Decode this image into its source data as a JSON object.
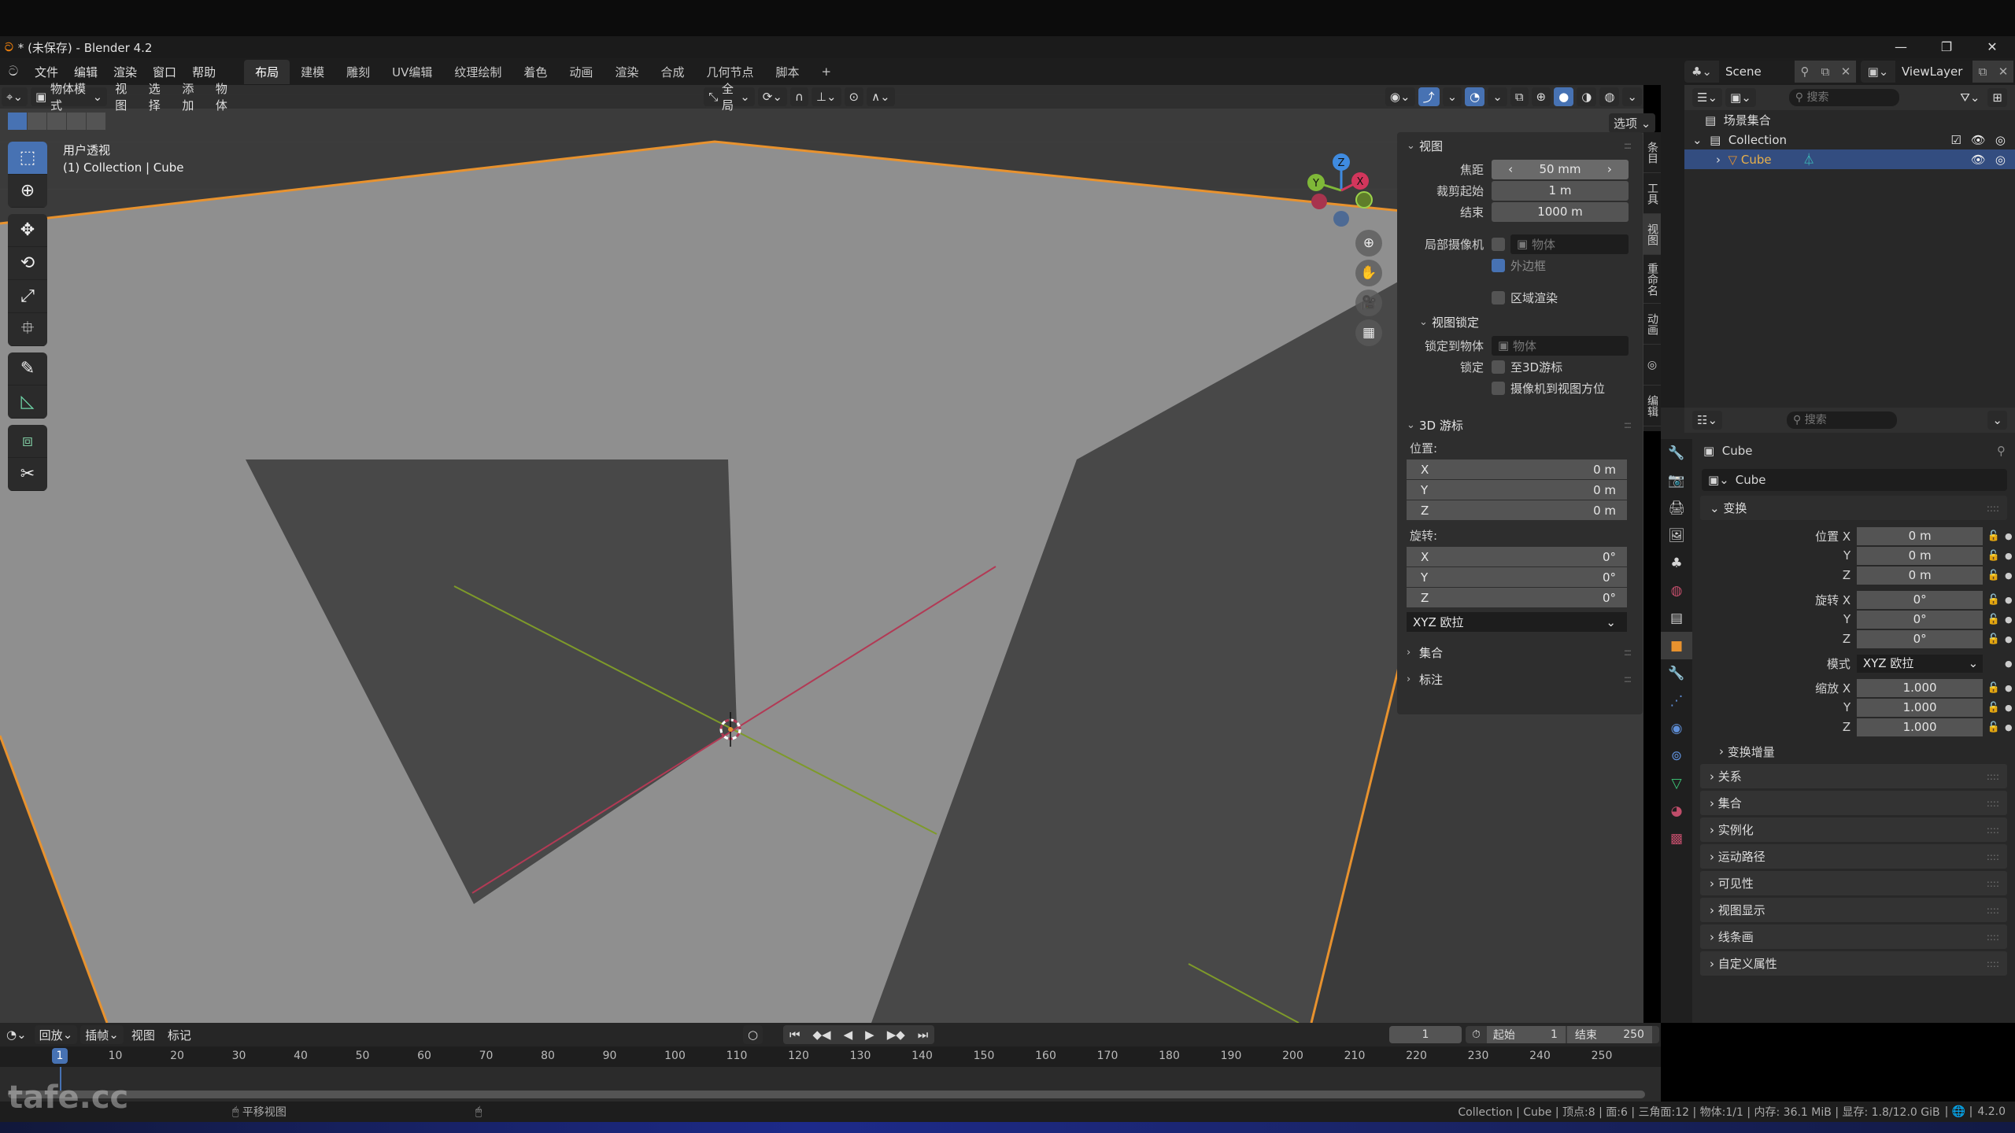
{
  "window": {
    "title": "* (未保存) - Blender 4.2",
    "controls": [
      "—",
      "❐",
      "✕"
    ]
  },
  "menubar": {
    "menus": [
      "文件",
      "编辑",
      "渲染",
      "窗口",
      "帮助"
    ],
    "workspaces": [
      "布局",
      "建模",
      "雕刻",
      "UV编辑",
      "纹理绘制",
      "着色",
      "动画",
      "渲染",
      "合成",
      "几何节点",
      "脚本"
    ],
    "active_workspace": "布局",
    "add_workspace": "+",
    "scene_name": "Scene",
    "view_layer": "ViewLayer"
  },
  "viewport_header": {
    "mode": "物体模式",
    "menus": [
      "视图",
      "选择",
      "添加",
      "物体"
    ],
    "orientation": "全局",
    "options": "选项"
  },
  "viewport": {
    "view_name": "用户透视",
    "context": "(1) Collection | Cube",
    "gizmo_axes": [
      "X",
      "Y",
      "Z"
    ],
    "colors": {
      "face_light": "#8f8f8f",
      "face_dark": "#484848",
      "outline": "#e8922e",
      "x_axis": "#b23a55",
      "y_axis": "#7e9a2a",
      "selection": "#4772b3"
    }
  },
  "npanel": {
    "tabs": [
      "条目",
      "工具",
      "视图",
      "重命名",
      "动画",
      "◎",
      "编辑"
    ],
    "active_tab": "视图",
    "view_section": {
      "title": "视图",
      "focal_label": "焦距",
      "focal_value": "50 mm",
      "clip_start_label": "裁剪起始",
      "clip_start_value": "1 m",
      "clip_end_label": "结束",
      "clip_end_value": "1000 m",
      "local_camera_label": "局部摄像机",
      "local_camera_placeholder": "物体",
      "border_label": "外边框",
      "border_checked": true,
      "region_render_label": "区域渲染",
      "region_render_checked": false
    },
    "view_lock": {
      "title": "视图锁定",
      "lock_object_label": "锁定到物体",
      "lock_object_placeholder": "物体",
      "lock_label": "锁定",
      "to_cursor_label": "至3D游标",
      "to_cursor_checked": false,
      "camera_to_view_label": "摄像机到视图方位",
      "camera_to_view_checked": false
    },
    "cursor": {
      "title": "3D 游标",
      "location_label": "位置:",
      "location": [
        {
          "axis": "X",
          "value": "0 m"
        },
        {
          "axis": "Y",
          "value": "0 m"
        },
        {
          "axis": "Z",
          "value": "0 m"
        }
      ],
      "rotation_label": "旋转:",
      "rotation": [
        {
          "axis": "X",
          "value": "0°"
        },
        {
          "axis": "Y",
          "value": "0°"
        },
        {
          "axis": "Z",
          "value": "0°"
        }
      ],
      "rotation_mode": "XYZ 欧拉"
    },
    "collapsed": [
      "集合",
      "标注"
    ]
  },
  "outliner": {
    "search_placeholder": "搜索",
    "root": "场景集合",
    "collection": "Collection",
    "object": "Cube"
  },
  "properties": {
    "search_placeholder": "搜索",
    "object_name": "Cube",
    "datablock_name": "Cube",
    "transform": {
      "title": "变换",
      "location_label": "位置 X",
      "location": [
        "0 m",
        "0 m",
        "0 m"
      ],
      "rotation_label": "旋转 X",
      "rotation": [
        "0°",
        "0°",
        "0°"
      ],
      "mode_label": "模式",
      "mode_value": "XYZ 欧拉",
      "scale_label": "缩放 X",
      "scale": [
        "1.000",
        "1.000",
        "1.000"
      ],
      "delta": "变换增量"
    },
    "sections": [
      "关系",
      "集合",
      "实例化",
      "运动路径",
      "可见性",
      "视图显示",
      "线条画",
      "自定义属性"
    ]
  },
  "timeline": {
    "menus": [
      "回放",
      "插帧",
      "视图",
      "标记"
    ],
    "current_frame": "1",
    "start_label": "起始",
    "start": "1",
    "end_label": "结束",
    "end": "250",
    "ticks": [
      "10",
      "20",
      "30",
      "40",
      "50",
      "60",
      "70",
      "80",
      "90",
      "100",
      "110",
      "120",
      "130",
      "140",
      "150",
      "160",
      "170",
      "180",
      "190",
      "200",
      "210",
      "220",
      "230",
      "240",
      "250"
    ]
  },
  "statusbar": {
    "hint": "平移视图",
    "stats": "Collection | Cube | 顶点:8 | 面:6 | 三角面:12 | 物体:1/1 | 内存: 36.1 MiB | 显存: 1.8/12.0 GiB",
    "version": "4.2.0"
  },
  "watermark": "tafe.cc"
}
